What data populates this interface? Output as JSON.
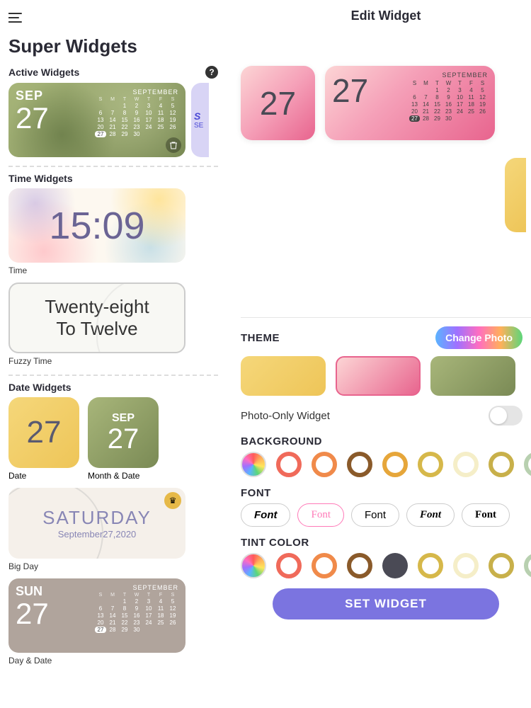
{
  "left": {
    "title": "Super Widgets",
    "sections": {
      "active": "Active Widgets",
      "time": "Time Widgets",
      "date": "Date Widgets"
    },
    "activeWidget": {
      "month": "SEP",
      "day": "27",
      "calTitle": "SEPTEMBER",
      "today": "27",
      "peek1": "S",
      "peek2": "SE"
    },
    "time": {
      "value": "15:09",
      "label": "Time"
    },
    "fuzzy": {
      "line1": "Twenty-eight",
      "line2": "To Twelve",
      "label": "Fuzzy Time"
    },
    "date": {
      "num": "27",
      "label1": "Date",
      "month": "SEP",
      "label2": "Month & Date"
    },
    "bigday": {
      "dow": "SATURDAY",
      "date": "September27,2020",
      "label": "Big Day"
    },
    "daydate": {
      "dow": "SUN",
      "num": "27",
      "calTitle": "SEPTEMBER",
      "label": "Day & Date"
    },
    "calDays": [
      "S",
      "M",
      "T",
      "W",
      "T",
      "F",
      "S"
    ],
    "calGrid": [
      "",
      "",
      "1",
      "2",
      "3",
      "4",
      "5",
      "6",
      "7",
      "8",
      "9",
      "10",
      "11",
      "12",
      "13",
      "14",
      "15",
      "16",
      "17",
      "18",
      "19",
      "20",
      "21",
      "22",
      "23",
      "24",
      "25",
      "26",
      "27",
      "28",
      "29",
      "30",
      "",
      ""
    ]
  },
  "right": {
    "title": "Edit Widget",
    "preview": {
      "num": "27",
      "calTitle": "SEPTEMBER",
      "today": "27"
    },
    "labels": {
      "theme": "THEME",
      "changePhoto": "Change Photo",
      "photoOnly": "Photo-Only Widget",
      "background": "BACKGROUND",
      "font": "FONT",
      "tint": "TINT COLOR",
      "setWidget": "SET WIDGET"
    },
    "fonts": [
      "Font",
      "Font",
      "Font",
      "Font",
      "Font"
    ],
    "bgColors": [
      "rainbow",
      "#f06a5a",
      "#f08a4a",
      "#8a5a2a",
      "#e6a63a",
      "#d6b84a",
      "#f5eec8",
      "#c8b04a",
      "#b8d0b0"
    ],
    "tintColors": [
      "rainbow",
      "#f06a5a",
      "#f08a4a",
      "#8a5a2a",
      "#4a4a55",
      "#d6b84a",
      "#f5eec8",
      "#c8b04a",
      "#b8d0b0"
    ]
  }
}
